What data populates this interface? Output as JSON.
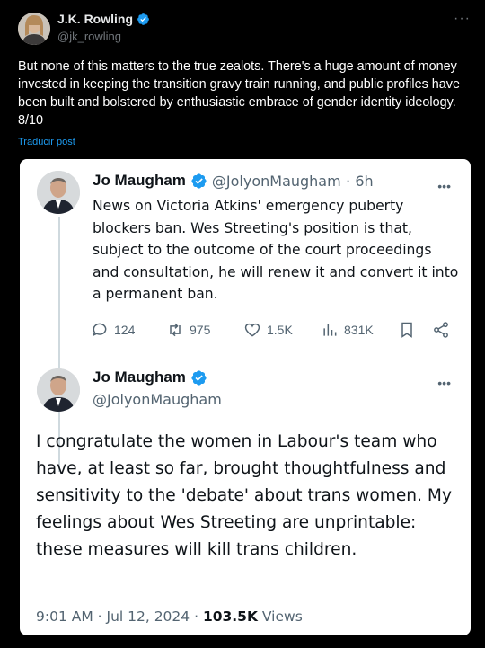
{
  "outer_tweet": {
    "author_name": "J.K. Rowling",
    "author_handle": "@jk_rowling",
    "text": "But none of this matters to the true zealots. There's a huge amount of money invested in keeping the transition gravy train running, and public profiles have been built and bolstered by enthusiastic embrace of gender identity ideology. 8/10",
    "translate_label": "Traducir post",
    "more_icon": "more-icon",
    "verified_color": "#1d9bf0"
  },
  "screenshot": {
    "reply": {
      "author_name": "Jo Maugham",
      "author_handle": "@JolyonMaugham",
      "separator": "·",
      "time": "6h",
      "text": "News on Victoria Atkins' emergency puberty blockers ban. Wes Streeting's position is that, subject to the outcome of the court proceedings and consultation, he will renew it and convert it into a permanent ban.",
      "actions": {
        "replies": "124",
        "reposts": "975",
        "likes": "1.5K",
        "views": "831K"
      }
    },
    "main": {
      "author_name": "Jo Maugham",
      "author_handle": "@JolyonMaugham",
      "text": "I congratulate the women in Labour's team who have, at least so far, brought thoughtfulness and sensitivity to the 'debate' about trans women. My feelings about Wes Streeting are unprintable: these measures will kill trans children.",
      "timestamp": "9:01 AM · Jul 12, 2024 · ",
      "views_count": "103.5K",
      "views_label": " Views"
    }
  },
  "colors": {
    "background": "#000000",
    "text_primary": "#e7e9ea",
    "text_secondary": "#71767b",
    "link": "#1d9bf0",
    "card_background": "#ffffff"
  }
}
